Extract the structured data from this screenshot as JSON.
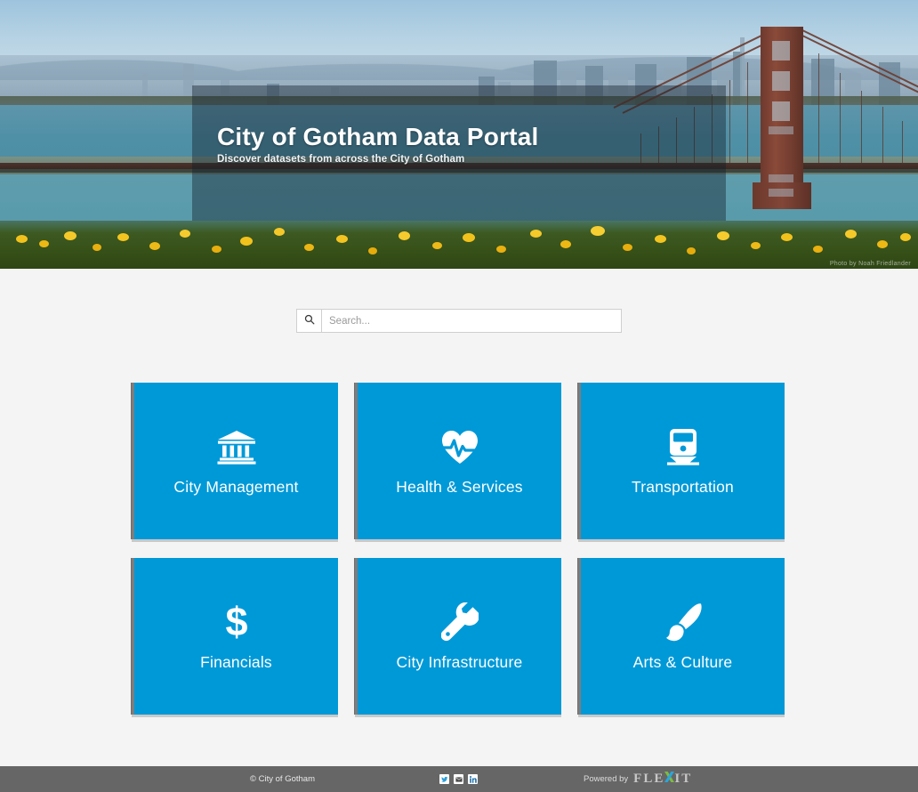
{
  "hero": {
    "title": "City of Gotham Data Portal",
    "subtitle": "Discover datasets from across the City of Gotham",
    "photo_credit": "Photo by Noah Friedlander",
    "overlay_color": "#14202c"
  },
  "search": {
    "placeholder": "Search...",
    "value": "",
    "button_icon": "search-icon"
  },
  "categories": [
    {
      "label": "City Management",
      "icon": "bank-icon"
    },
    {
      "label": "Health & Services",
      "icon": "heartbeat-icon"
    },
    {
      "label": "Transportation",
      "icon": "train-icon"
    },
    {
      "label": "Financials",
      "icon": "dollar-icon"
    },
    {
      "label": "City Infrastructure",
      "icon": "wrench-icon"
    },
    {
      "label": "Arts & Culture",
      "icon": "paintbrush-icon"
    }
  ],
  "footer": {
    "copyright": "© City of Gotham",
    "socials": [
      {
        "name": "twitter-icon",
        "label": "Twitter"
      },
      {
        "name": "email-icon",
        "label": "Email"
      },
      {
        "name": "linkedin-icon",
        "label": "LinkedIn"
      }
    ],
    "powered_by_label": "Powered by",
    "brand_parts": {
      "pre": "FLE",
      "x": "X",
      "post": "IT"
    },
    "brand_full": "FLEXIT"
  },
  "theme": {
    "tile_blue": "#0099d8",
    "page_background": "#f4f4f4",
    "footer_background": "#666666",
    "brand_green": "#7dbb42",
    "brand_blue": "#2aa6dd"
  }
}
